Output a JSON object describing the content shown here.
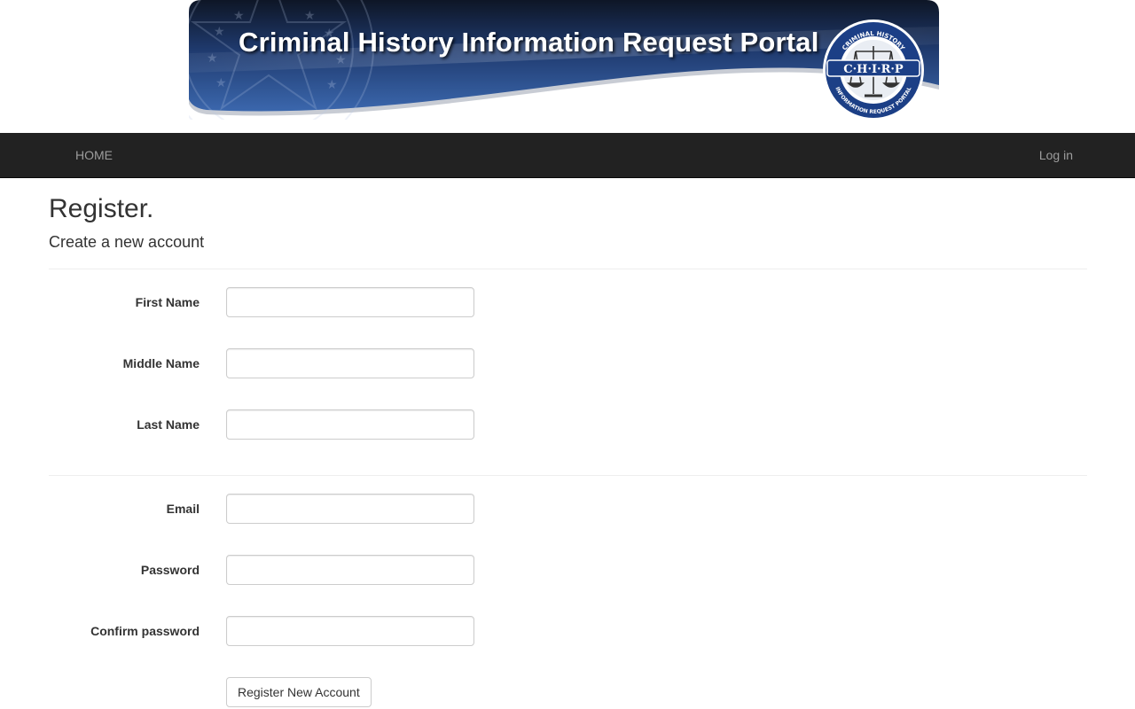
{
  "banner": {
    "title": "Criminal History Information Request Portal",
    "logo_text_top": "CRIMINAL HISTORY",
    "logo_acronym": "C·H·I·R·P",
    "logo_text_bottom": "INFORMATION REQUEST PORTAL",
    "colors": {
      "banner_blue": "#2f5aa0",
      "banner_dark": "#0f1a2e"
    }
  },
  "nav": {
    "home_label": "HOME",
    "login_label": "Log in",
    "colors": {
      "bar": "#222222",
      "link": "#9d9d9d"
    }
  },
  "page": {
    "title": "Register.",
    "subtitle": "Create a new account"
  },
  "form": {
    "first_name": {
      "label": "First Name",
      "value": ""
    },
    "middle_name": {
      "label": "Middle Name",
      "value": ""
    },
    "last_name": {
      "label": "Last Name",
      "value": ""
    },
    "email": {
      "label": "Email",
      "value": ""
    },
    "password": {
      "label": "Password",
      "value": ""
    },
    "confirm_password": {
      "label": "Confirm password",
      "value": ""
    },
    "submit_label": "Register New Account"
  }
}
